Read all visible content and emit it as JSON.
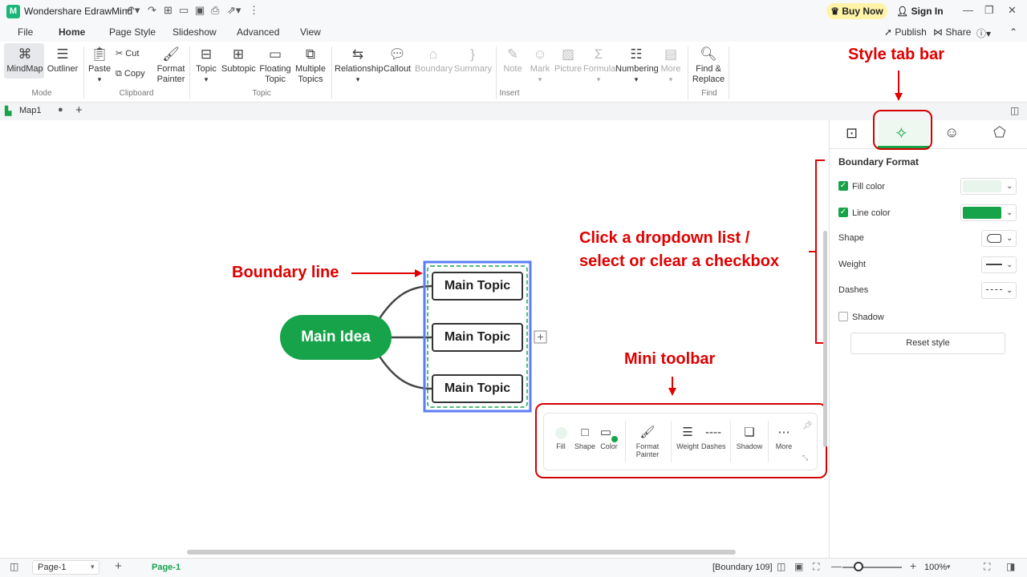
{
  "app": {
    "title": "Wondershare EdrawMind",
    "buy_now": "Buy Now",
    "sign_in": "Sign In",
    "publish": "Publish",
    "share": "Share"
  },
  "menu": [
    "File",
    "Home",
    "Page Style",
    "Slideshow",
    "Advanced",
    "View"
  ],
  "ribbon": {
    "mode": {
      "mindmap": "MindMap",
      "outliner": "Outliner",
      "group": "Mode"
    },
    "clipboard": {
      "paste": "Paste",
      "cut": "Cut",
      "copy": "Copy",
      "format_painter_1": "Format",
      "format_painter_2": "Painter",
      "group": "Clipboard"
    },
    "topic": {
      "topic": "Topic",
      "subtopic": "Subtopic",
      "floating_1": "Floating",
      "floating_2": "Topic",
      "multiple_1": "Multiple",
      "multiple_2": "Topics",
      "group": "Topic"
    },
    "insert": {
      "relationship": "Relationship",
      "callout": "Callout",
      "boundary": "Boundary",
      "summary": "Summary",
      "note": "Note",
      "mark": "Mark",
      "picture": "Picture",
      "formula": "Formula",
      "numbering": "Numbering",
      "more": "More",
      "group": "Insert"
    },
    "find": {
      "find_1": "Find &",
      "find_2": "Replace",
      "group": "Find"
    }
  },
  "doc_tab": {
    "name": "Map1"
  },
  "canvas": {
    "main_idea": "Main Idea",
    "topics": [
      "Main Topic",
      "Main Topic",
      "Main Topic"
    ]
  },
  "annotations": {
    "style_tab_bar": "Style tab bar",
    "boundary_line": "Boundary line",
    "dropdown_1": "Click a dropdown list /",
    "dropdown_2": "select or clear a checkbox",
    "mini_toolbar": "Mini toolbar"
  },
  "panel": {
    "title": "Boundary Format",
    "fill_color": "Fill color",
    "line_color": "Line color",
    "shape": "Shape",
    "weight": "Weight",
    "dashes": "Dashes",
    "shadow": "Shadow",
    "reset": "Reset style",
    "fill_checked": true,
    "line_checked": true,
    "shadow_checked": false,
    "fill_swatch": "#e8f5ec",
    "line_swatch": "#16a34a"
  },
  "mini_toolbar": {
    "fill": "Fill",
    "shape": "Shape",
    "color": "Color",
    "fp_1": "Format",
    "fp_2": "Painter",
    "weight": "Weight",
    "dashes": "Dashes",
    "shadow": "Shadow",
    "more": "More"
  },
  "status": {
    "page_select": "Page-1",
    "page_tab": "Page-1",
    "selection": "[Boundary 109]",
    "zoom": "100%"
  },
  "colors": {
    "accent": "#16a34a",
    "annotation": "#e00000",
    "selection": "#5b7cf7"
  }
}
